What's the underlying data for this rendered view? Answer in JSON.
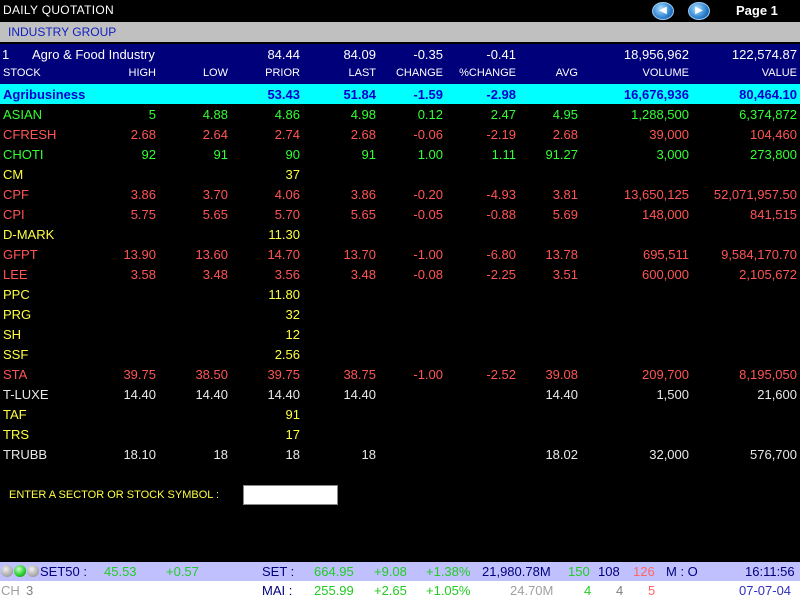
{
  "header": {
    "title": "DAILY QUOTATION",
    "page_label": "Page 1",
    "prev_glyph": "◀",
    "next_glyph": "▶",
    "group_label": "INDUSTRY GROUP"
  },
  "industry": {
    "num": "1",
    "name": "Agro & Food Industry",
    "high": "84.44",
    "low": "84.09",
    "change": "-0.35",
    "pchange": "-0.41",
    "volume": "18,956,962",
    "value": "122,574.87"
  },
  "columns": {
    "stock": "STOCK",
    "high": "HIGH",
    "low": "LOW",
    "prior": "PRIOR",
    "last": "LAST",
    "change": "CHANGE",
    "pchange": "%CHANGE",
    "avg": "AVG",
    "volume": "VOLUME",
    "value": "VALUE"
  },
  "sector": {
    "name": "Agribusiness",
    "prior": "53.43",
    "last": "51.84",
    "change": "-1.59",
    "pchange": "-2.98",
    "volume": "16,676,936",
    "value": "80,464.10"
  },
  "stocks": [
    {
      "stock": "ASIAN",
      "high": "5",
      "low": "4.88",
      "prior": "4.86",
      "last": "4.98",
      "change": "0.12",
      "pchange": "2.47",
      "avg": "4.95",
      "volume": "1,288,500",
      "value": "6,374,872",
      "color": "green"
    },
    {
      "stock": "CFRESH",
      "high": "2.68",
      "low": "2.64",
      "prior": "2.74",
      "last": "2.68",
      "change": "-0.06",
      "pchange": "-2.19",
      "avg": "2.68",
      "volume": "39,000",
      "value": "104,460",
      "color": "red"
    },
    {
      "stock": "CHOTI",
      "high": "92",
      "low": "91",
      "prior": "90",
      "last": "91",
      "change": "1.00",
      "pchange": "1.11",
      "avg": "91.27",
      "volume": "3,000",
      "value": "273,800",
      "color": "green"
    },
    {
      "stock": "CM",
      "high": "",
      "low": "",
      "prior": "37",
      "last": "",
      "change": "",
      "pchange": "",
      "avg": "",
      "volume": "",
      "value": "",
      "color": "yellow"
    },
    {
      "stock": "CPF",
      "high": "3.86",
      "low": "3.70",
      "prior": "4.06",
      "last": "3.86",
      "change": "-0.20",
      "pchange": "-4.93",
      "avg": "3.81",
      "volume": "13,650,125",
      "value": "52,071,957.50",
      "color": "red"
    },
    {
      "stock": "CPI",
      "high": "5.75",
      "low": "5.65",
      "prior": "5.70",
      "last": "5.65",
      "change": "-0.05",
      "pchange": "-0.88",
      "avg": "5.69",
      "volume": "148,000",
      "value": "841,515",
      "color": "red"
    },
    {
      "stock": "D-MARK",
      "high": "",
      "low": "",
      "prior": "11.30",
      "last": "",
      "change": "",
      "pchange": "",
      "avg": "",
      "volume": "",
      "value": "",
      "color": "yellow"
    },
    {
      "stock": "GFPT",
      "high": "13.90",
      "low": "13.60",
      "prior": "14.70",
      "last": "13.70",
      "change": "-1.00",
      "pchange": "-6.80",
      "avg": "13.78",
      "volume": "695,511",
      "value": "9,584,170.70",
      "color": "red"
    },
    {
      "stock": "LEE",
      "high": "3.58",
      "low": "3.48",
      "prior": "3.56",
      "last": "3.48",
      "change": "-0.08",
      "pchange": "-2.25",
      "avg": "3.51",
      "volume": "600,000",
      "value": "2,105,672",
      "color": "red"
    },
    {
      "stock": "PPC",
      "high": "",
      "low": "",
      "prior": "11.80",
      "last": "",
      "change": "",
      "pchange": "",
      "avg": "",
      "volume": "",
      "value": "",
      "color": "yellow"
    },
    {
      "stock": "PRG",
      "high": "",
      "low": "",
      "prior": "32",
      "last": "",
      "change": "",
      "pchange": "",
      "avg": "",
      "volume": "",
      "value": "",
      "color": "yellow"
    },
    {
      "stock": "SH",
      "high": "",
      "low": "",
      "prior": "12",
      "last": "",
      "change": "",
      "pchange": "",
      "avg": "",
      "volume": "",
      "value": "",
      "color": "yellow"
    },
    {
      "stock": "SSF",
      "high": "",
      "low": "",
      "prior": "2.56",
      "last": "",
      "change": "",
      "pchange": "",
      "avg": "",
      "volume": "",
      "value": "",
      "color": "yellow"
    },
    {
      "stock": "STA",
      "high": "39.75",
      "low": "38.50",
      "prior": "39.75",
      "last": "38.75",
      "change": "-1.00",
      "pchange": "-2.52",
      "avg": "39.08",
      "volume": "209,700",
      "value": "8,195,050",
      "color": "red"
    },
    {
      "stock": "T-LUXE",
      "high": "14.40",
      "low": "14.40",
      "prior": "14.40",
      "last": "14.40",
      "change": "",
      "pchange": "",
      "avg": "14.40",
      "volume": "1,500",
      "value": "21,600",
      "color": "white"
    },
    {
      "stock": "TAF",
      "high": "",
      "low": "",
      "prior": "91",
      "last": "",
      "change": "",
      "pchange": "",
      "avg": "",
      "volume": "",
      "value": "",
      "color": "yellow"
    },
    {
      "stock": "TRS",
      "high": "",
      "low": "",
      "prior": "17",
      "last": "",
      "change": "",
      "pchange": "",
      "avg": "",
      "volume": "",
      "value": "",
      "color": "yellow"
    },
    {
      "stock": "TRUBB",
      "high": "18.10",
      "low": "18",
      "prior": "18",
      "last": "18",
      "change": "",
      "pchange": "",
      "avg": "18.02",
      "volume": "32,000",
      "value": "576,700",
      "color": "white"
    }
  ],
  "input": {
    "prompt": "ENTER A SECTOR OR STOCK SYMBOL :",
    "value": ""
  },
  "status1": {
    "set50_label": "SET50 :",
    "set50_value": "45.53",
    "set50_change": "+0.57",
    "set_label": "SET :",
    "set_value": "664.95",
    "set_change": "+9.08",
    "set_pchange": "+1.38%",
    "set_turnover": "21,980.78M",
    "up": "150",
    "unchanged": "108",
    "down": "126",
    "market_status": "M : O",
    "time": "16:11:56"
  },
  "status2": {
    "ch_label": "CH",
    "ch_value": "3",
    "mai_label": "MAI :",
    "mai_value": "255.99",
    "mai_change": "+2.65",
    "mai_pchange": "+1.05%",
    "mai_turnover": "24.70M",
    "up": "4",
    "unchanged": "4",
    "down": "5",
    "date": "07-07-04"
  }
}
